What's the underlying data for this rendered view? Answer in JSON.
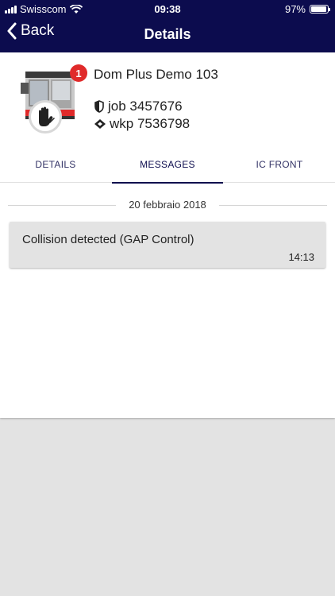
{
  "status_bar": {
    "carrier": "Swisscom",
    "time": "09:38",
    "battery": "97%",
    "battery_level": 0.97
  },
  "nav": {
    "back_label": "Back",
    "title": "Details"
  },
  "device": {
    "name": "Dom Plus Demo 103",
    "badge_count": "1",
    "job": "job 3457676",
    "wkp": "wkp 7536798",
    "status_icon": "stop-hand-icon"
  },
  "tabs": [
    {
      "label": "DETAILS",
      "active": false
    },
    {
      "label": "MESSAGES",
      "active": true
    },
    {
      "label": "IC FRONT",
      "active": false
    }
  ],
  "messages": {
    "date": "20 febbraio 2018",
    "items": [
      {
        "text": "Collision detected (GAP Control)",
        "time": "14:13"
      }
    ]
  },
  "colors": {
    "primary": "#0c0c4e",
    "badge": "#e02a2a",
    "message_bg": "#e3e3e3"
  }
}
